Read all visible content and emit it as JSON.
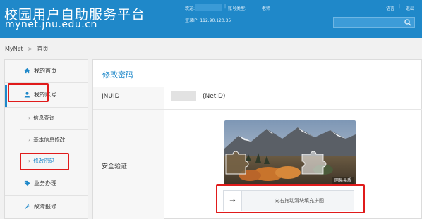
{
  "header": {
    "title_cn": "校园用户自助服务平台",
    "domain": "mynet.jnu.edu.cn",
    "welcome_label": "欢迎:",
    "account_type_label": "账号类型:",
    "account_type_value": "老师",
    "login_ip": "登录IP: 112.90.120.35",
    "language": "语言",
    "logout": "退出",
    "search_placeholder": ""
  },
  "breadcrumb": {
    "root": "MyNet",
    "separator": ">",
    "current": "首页"
  },
  "sidebar": {
    "items": [
      {
        "label": "我的首页",
        "icon": "home-icon"
      },
      {
        "label": "我的账号",
        "icon": "user-icon"
      },
      {
        "label": "信息查询"
      },
      {
        "label": "基本信息修改"
      },
      {
        "label": "修改密码"
      },
      {
        "label": "业务办理",
        "icon": "tag-icon"
      },
      {
        "label": "故障报修",
        "icon": "wrench-icon"
      }
    ]
  },
  "main": {
    "title": "修改密码",
    "jnuid_label": "JNUID",
    "netid_suffix": "(NetID)",
    "security_label": "安全验证",
    "captcha_badge": "网易易盾",
    "slider_text": "向右拖动滑块填充拼图",
    "slider_arrow": "→"
  },
  "colors": {
    "brand": "#1f88c9",
    "highlight": "#e01b1b"
  }
}
